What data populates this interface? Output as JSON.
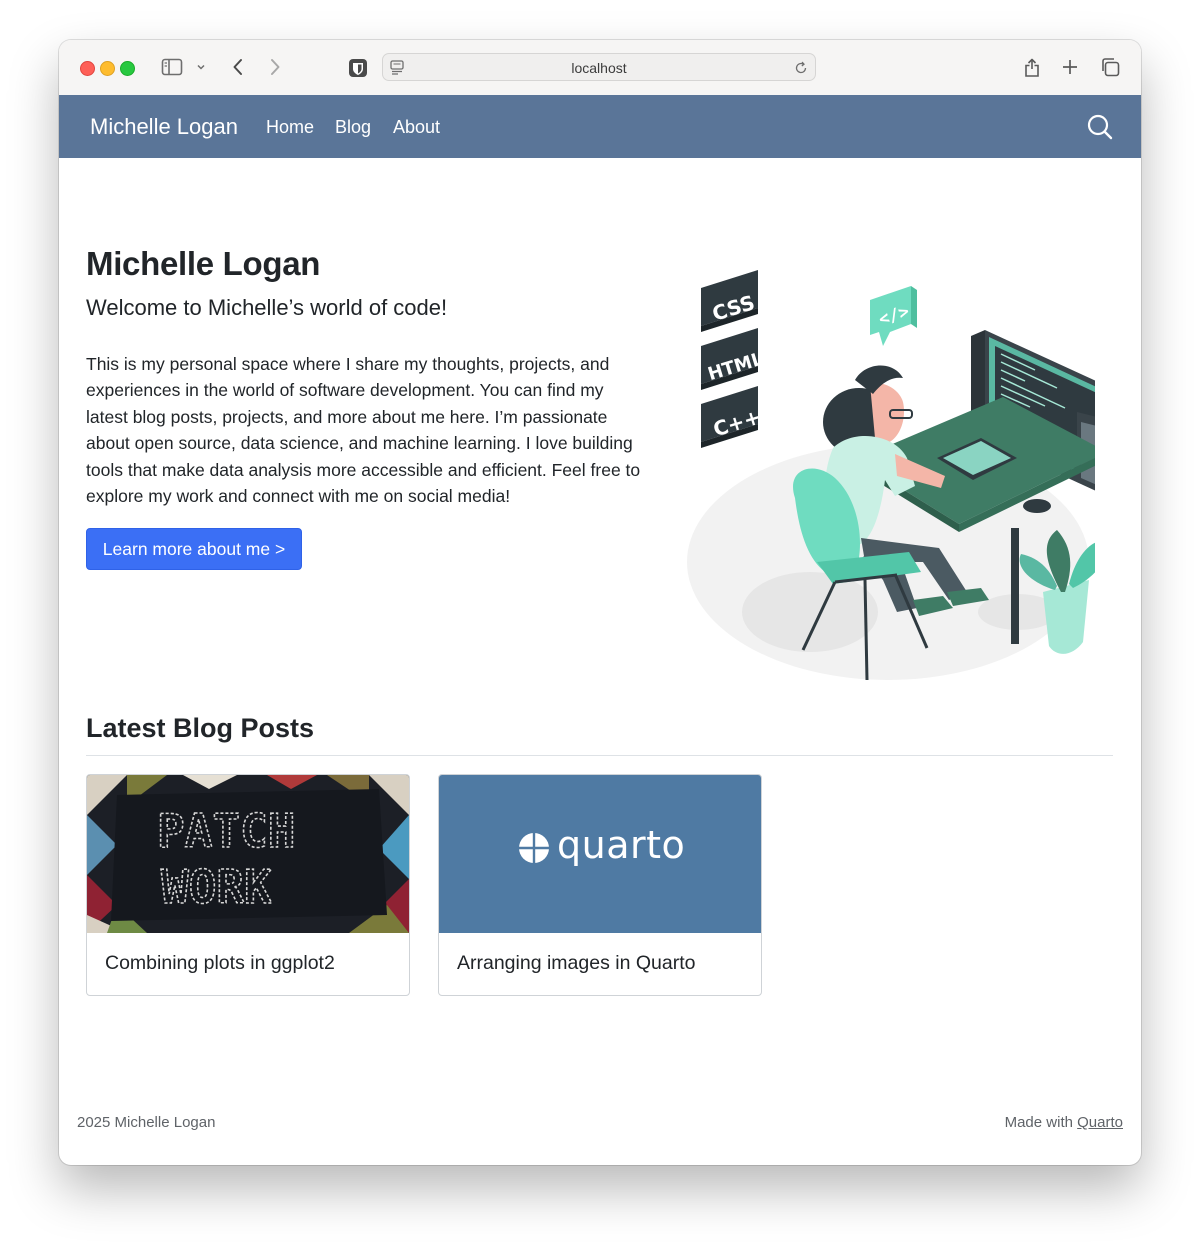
{
  "browser": {
    "address": "localhost",
    "icons": [
      "sidebar-icon",
      "chevron-down-icon",
      "back-arrow-icon",
      "forward-arrow-icon",
      "shield-icon",
      "page-icon",
      "reload-icon",
      "share-icon",
      "plus-icon",
      "tabs-icon"
    ]
  },
  "navbar": {
    "brand": "Michelle Logan",
    "links": [
      "Home",
      "Blog",
      "About"
    ],
    "search_icon": "search-icon",
    "color": "#5a7598"
  },
  "hero": {
    "title": "Michelle Logan",
    "subtitle": "Welcome to Michelle’s world of code!",
    "body": "This is my personal space where I share my thoughts, projects, and experiences in the world of software development. You can find my latest blog posts, projects, and more about me here. I’m passionate about open source, data science, and machine learning. I love building tools that make data analysis more accessible and efficient. Feel free to explore my work and connect with me on social media!",
    "button_label": "Learn more about me >",
    "button_color": "#3b6ff5",
    "illustration": {
      "tags": [
        "CSS",
        "HTML",
        "C++"
      ],
      "bubble": "</>"
    }
  },
  "blog": {
    "heading": "Latest Blog Posts",
    "posts": [
      {
        "title": "Combining plots in ggplot2",
        "image_text": [
          "PATCH",
          "WORK"
        ]
      },
      {
        "title": "Arranging images in Quarto",
        "image_text": "quarto",
        "image_color": "#4f7aa3"
      }
    ]
  },
  "footer": {
    "copyright": "2025 Michelle Logan",
    "made_with": "Made with",
    "made_with_link": "Quarto"
  }
}
